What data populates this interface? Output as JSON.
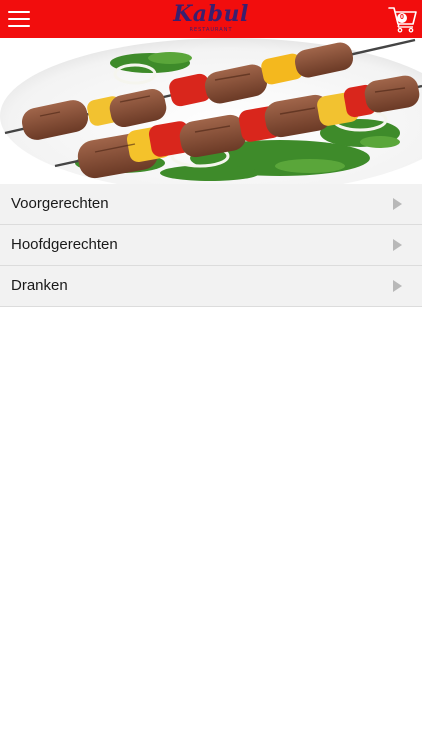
{
  "header": {
    "menu_icon": "hamburger-menu-icon",
    "logo": {
      "name": "Kabul",
      "tagline": "RESTAURANT",
      "color": "#3a1f6e"
    },
    "cart": {
      "icon": "shopping-cart-icon",
      "count": "0"
    },
    "bar_color": "#f20d0d"
  },
  "hero": {
    "image": "kebab-skewers-photo"
  },
  "categories": [
    {
      "label": "Voorgerechten"
    },
    {
      "label": "Hoofdgerechten"
    },
    {
      "label": "Dranken"
    }
  ]
}
